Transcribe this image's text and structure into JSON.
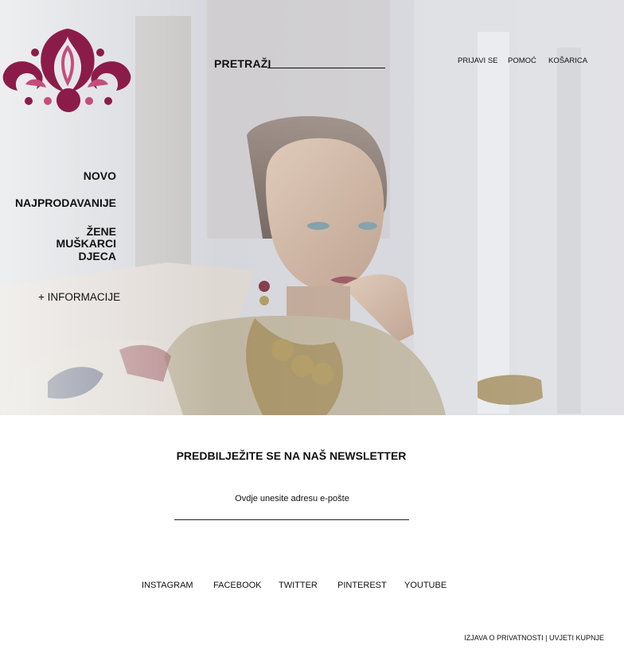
{
  "header": {
    "search_label": "PRETRAŽI",
    "login": "PRIJAVI SE",
    "help": "POMOĆ",
    "cart": "KOŠARICA"
  },
  "sidebar": {
    "items": [
      "NOVO",
      "NAJPRODAVANIJE",
      "ŽENE",
      "MUŠKARCI",
      "DJECA"
    ],
    "more_info": "+ INFORMACIJE"
  },
  "newsletter": {
    "title": "PREDBILJEŽITE SE NA NAŠ NEWSLETTER",
    "email_placeholder": "Ovdje unesite adresu e-pošte"
  },
  "social": [
    "INSTAGRAM",
    "FACEBOOK",
    "TWITTER",
    "PINTEREST",
    "YOUTUBE"
  ],
  "footer": {
    "links": "IZJAVA O PRIVATNOSTI | UVJETI KUPNJE"
  },
  "colors": {
    "brand": "#8b1c4a",
    "brand_light": "#c44d7c"
  }
}
